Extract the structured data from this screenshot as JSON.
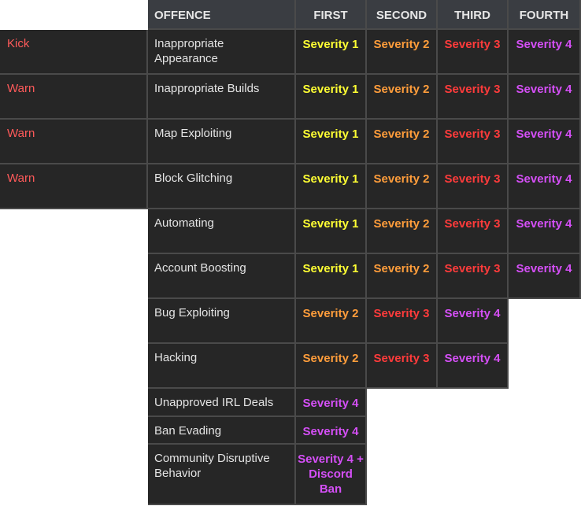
{
  "headers": {
    "offence": "OFFENCE",
    "first": "FIRST",
    "second": "SECOND",
    "third": "THIRD",
    "fourth": "FOURTH"
  },
  "severity_colors": {
    "severity_1": "#ffff33",
    "severity_2": "#ff9d3b",
    "severity_3": "#ff3b3b",
    "severity_4": "#d54ff7",
    "action_text": "#ff5a5a"
  },
  "rows": [
    {
      "action": "Kick",
      "offence": "Inappropriate Appearance",
      "first": "Severity 1",
      "second": "Severity 2",
      "third": "Severity 3",
      "fourth": "Severity 4"
    },
    {
      "action": "Warn",
      "offence": "Inappropriate Builds",
      "first": "Severity 1",
      "second": "Severity 2",
      "third": "Severity 3",
      "fourth": "Severity 4"
    },
    {
      "action": "Warn",
      "offence": "Map Exploiting",
      "first": "Severity 1",
      "second": "Severity 2",
      "third": "Severity 3",
      "fourth": "Severity 4"
    },
    {
      "action": "Warn",
      "offence": "Block Glitching",
      "first": "Severity 1",
      "second": "Severity 2",
      "third": "Severity 3",
      "fourth": "Severity 4"
    },
    {
      "offence": "Automating",
      "first": "Severity 1",
      "second": "Severity 2",
      "third": "Severity 3",
      "fourth": "Severity 4"
    },
    {
      "offence": "Account Boosting",
      "first": "Severity 1",
      "second": "Severity 2",
      "third": "Severity 3",
      "fourth": "Severity 4"
    },
    {
      "offence": "Bug Exploiting",
      "first": "Severity 2",
      "second": "Severity 3",
      "third": "Severity 4"
    },
    {
      "offence": "Hacking",
      "first": "Severity 2",
      "second": "Severity 3",
      "third": "Severity 4"
    },
    {
      "offence": "Unapproved IRL Deals",
      "first": "Severity 4"
    },
    {
      "offence": "Ban Evading",
      "first": "Severity 4"
    },
    {
      "offence": "Community Disruptive Behavior",
      "first": "Severity 4 + Discord Ban"
    }
  ]
}
